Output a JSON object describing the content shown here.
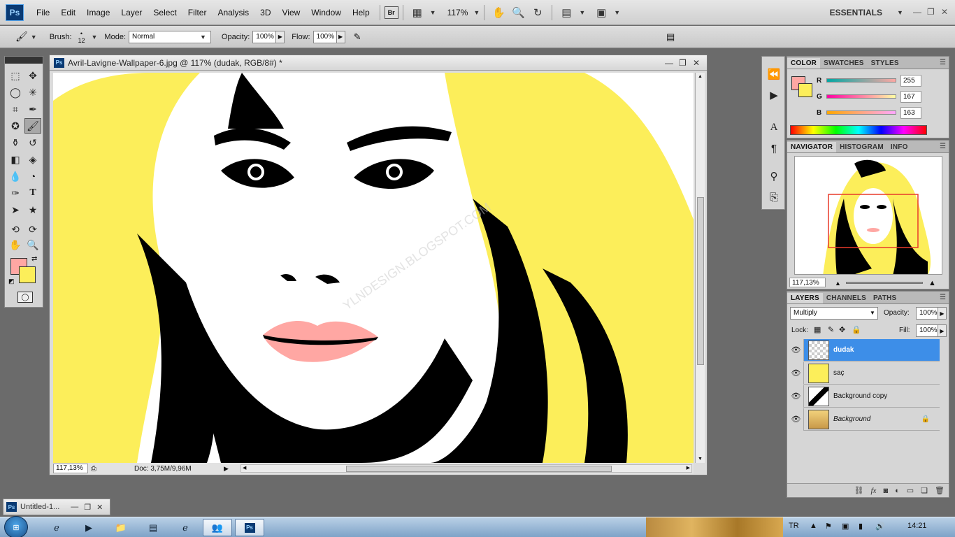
{
  "app": {
    "logo": "Ps"
  },
  "menu": {
    "items": [
      "File",
      "Edit",
      "Image",
      "Layer",
      "Select",
      "Filter",
      "Analysis",
      "3D",
      "View",
      "Window",
      "Help"
    ],
    "bridge": "Br",
    "zoom": "117%",
    "workspace": "ESSENTIALS"
  },
  "options": {
    "brush_label": "Brush:",
    "brush_size": "12",
    "mode_label": "Mode:",
    "mode_value": "Normal",
    "opacity_label": "Opacity:",
    "opacity_value": "100%",
    "flow_label": "Flow:",
    "flow_value": "100%"
  },
  "document": {
    "title": "Avril-Lavigne-Wallpaper-6.jpg @ 117% (dudak, RGB/8#) *",
    "zoom": "117,13%",
    "doc_size": "Doc: 3,75M/9,96M"
  },
  "minimized_doc": {
    "title": "Untitled-1..."
  },
  "color_panel": {
    "tabs": [
      "COLOR",
      "SWATCHES",
      "STYLES"
    ],
    "r_label": "R",
    "g_label": "G",
    "b_label": "B",
    "r": "255",
    "g": "167",
    "b": "163",
    "foreground": "#ffa7a3",
    "background": "#fcee5a"
  },
  "navigator_panel": {
    "tabs": [
      "NAVIGATOR",
      "HISTOGRAM",
      "INFO"
    ],
    "zoom": "117,13%"
  },
  "layers_panel": {
    "tabs": [
      "LAYERS",
      "CHANNELS",
      "PATHS"
    ],
    "blend_mode": "Multiply",
    "opacity_label": "Opacity:",
    "opacity_value": "100%",
    "lock_label": "Lock:",
    "fill_label": "Fill:",
    "fill_value": "100%",
    "layers": [
      {
        "name": "dudak",
        "selected": true
      },
      {
        "name": "saç",
        "selected": false
      },
      {
        "name": "Background copy",
        "selected": false
      },
      {
        "name": "Background",
        "selected": false,
        "locked": true
      }
    ]
  },
  "taskbar": {
    "lang": "TR",
    "time": "14:21"
  },
  "icons": [
    "hand-icon",
    "zoom-icon",
    "rotate-icon",
    "brush-icon",
    "eye-icon",
    "lock-icon",
    "trash-icon"
  ]
}
